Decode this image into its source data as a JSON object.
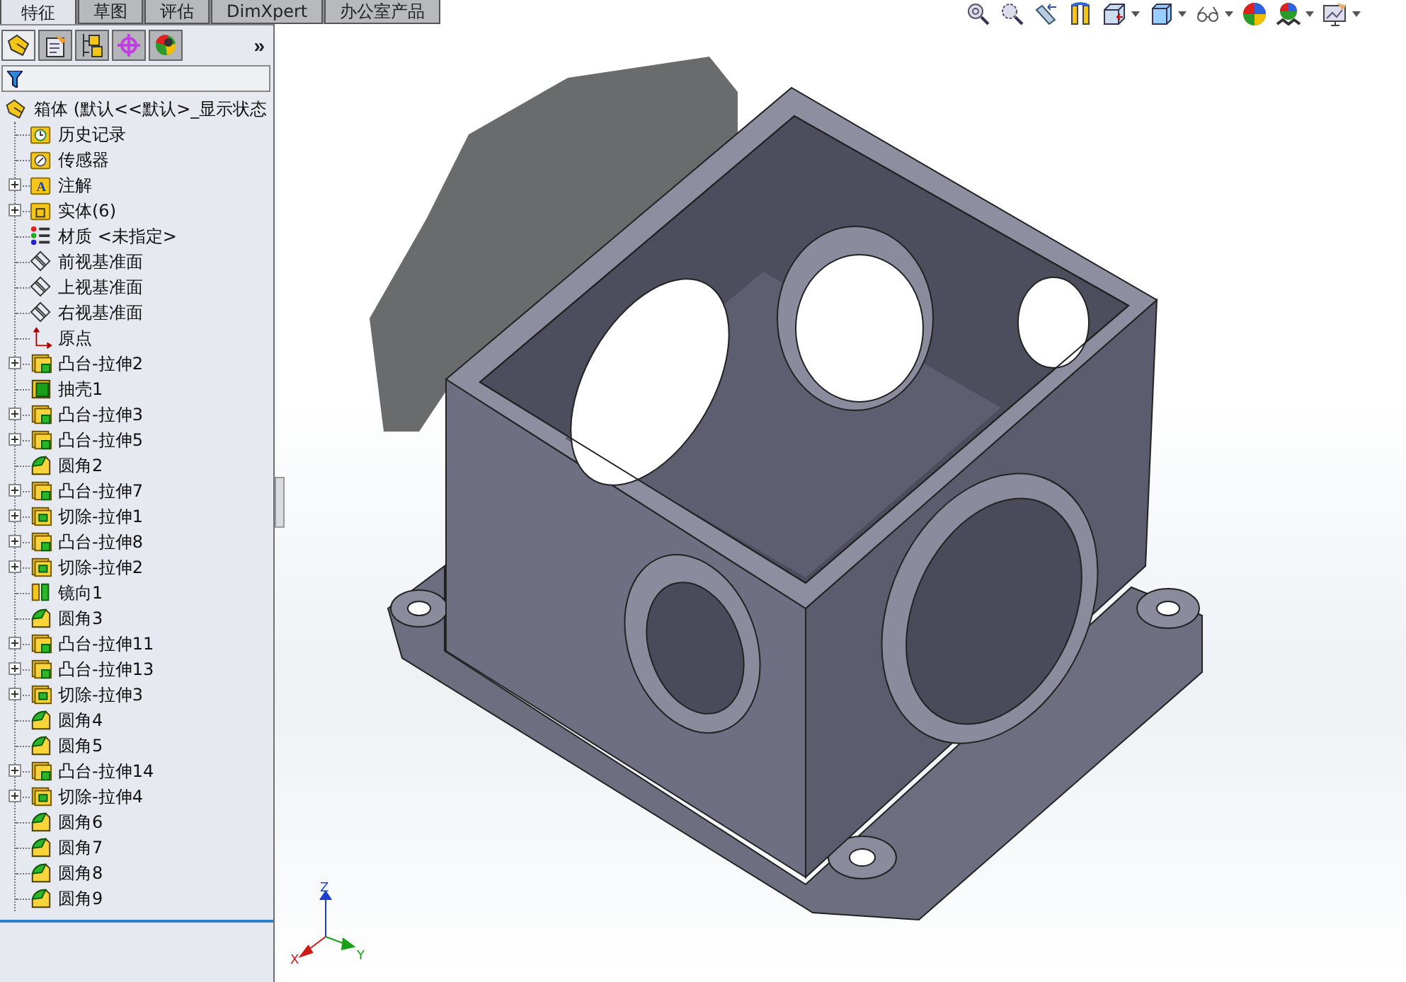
{
  "command_tabs": [
    {
      "label": "特征",
      "selected": true
    },
    {
      "label": "草图",
      "selected": false
    },
    {
      "label": "评估",
      "selected": false
    },
    {
      "label": "DimXpert",
      "selected": false
    },
    {
      "label": "办公室产品",
      "selected": false
    }
  ],
  "view_toolbar": [
    {
      "kind": "zoom-fit",
      "dropdown": false
    },
    {
      "kind": "zoom-area",
      "dropdown": false
    },
    {
      "kind": "previous-view",
      "dropdown": false
    },
    {
      "kind": "section",
      "dropdown": false
    },
    {
      "kind": "orientation",
      "dropdown": true
    },
    {
      "kind": "display-style",
      "dropdown": true
    },
    {
      "kind": "hide-show",
      "dropdown": true
    },
    {
      "kind": "appearance",
      "dropdown": false
    },
    {
      "kind": "scene",
      "dropdown": true
    },
    {
      "kind": "view-settings",
      "dropdown": true
    }
  ],
  "panel_tabs": [
    {
      "kind": "feature",
      "selected": true
    },
    {
      "kind": "property",
      "selected": false
    },
    {
      "kind": "configuration",
      "selected": false
    },
    {
      "kind": "dimxpert",
      "selected": false
    },
    {
      "kind": "display",
      "selected": false
    }
  ],
  "panel_more": "»",
  "tree": {
    "root": "箱体 (默认<<默认>_显示状态",
    "children": [
      {
        "label": "历史记录",
        "kind": "history",
        "expandable": false
      },
      {
        "label": "传感器",
        "kind": "sensor",
        "expandable": false
      },
      {
        "label": "注解",
        "kind": "annotation",
        "expandable": true,
        "icon_text": "A"
      },
      {
        "label": "实体(6)",
        "kind": "bodies",
        "expandable": true
      },
      {
        "label": "材质 <未指定>",
        "kind": "material",
        "expandable": false
      },
      {
        "label": "前视基准面",
        "kind": "plane",
        "expandable": false
      },
      {
        "label": "上视基准面",
        "kind": "plane",
        "expandable": false
      },
      {
        "label": "右视基准面",
        "kind": "plane",
        "expandable": false
      },
      {
        "label": "原点",
        "kind": "origin",
        "expandable": false
      },
      {
        "label": "凸台-拉伸2",
        "kind": "boss",
        "expandable": true
      },
      {
        "label": "抽壳1",
        "kind": "shell",
        "expandable": false
      },
      {
        "label": "凸台-拉伸3",
        "kind": "boss",
        "expandable": true
      },
      {
        "label": "凸台-拉伸5",
        "kind": "boss",
        "expandable": true
      },
      {
        "label": "圆角2",
        "kind": "fillet",
        "expandable": false
      },
      {
        "label": "凸台-拉伸7",
        "kind": "boss",
        "expandable": true
      },
      {
        "label": "切除-拉伸1",
        "kind": "cut",
        "expandable": true
      },
      {
        "label": "凸台-拉伸8",
        "kind": "boss",
        "expandable": true
      },
      {
        "label": "切除-拉伸2",
        "kind": "cut",
        "expandable": true
      },
      {
        "label": "镜向1",
        "kind": "mirror",
        "expandable": false
      },
      {
        "label": "圆角3",
        "kind": "fillet",
        "expandable": false
      },
      {
        "label": "凸台-拉伸11",
        "kind": "boss",
        "expandable": true
      },
      {
        "label": "凸台-拉伸13",
        "kind": "boss",
        "expandable": true
      },
      {
        "label": "切除-拉伸3",
        "kind": "cut",
        "expandable": true
      },
      {
        "label": "圆角4",
        "kind": "fillet",
        "expandable": false
      },
      {
        "label": "圆角5",
        "kind": "fillet",
        "expandable": false
      },
      {
        "label": "凸台-拉伸14",
        "kind": "boss",
        "expandable": true
      },
      {
        "label": "切除-拉伸4",
        "kind": "cut",
        "expandable": true
      },
      {
        "label": "圆角6",
        "kind": "fillet",
        "expandable": false
      },
      {
        "label": "圆角7",
        "kind": "fillet",
        "expandable": false
      },
      {
        "label": "圆角8",
        "kind": "fillet",
        "expandable": false
      },
      {
        "label": "圆角9",
        "kind": "fillet",
        "expandable": false
      }
    ]
  },
  "triad": {
    "x": "X",
    "y": "Y",
    "z": "Z"
  }
}
